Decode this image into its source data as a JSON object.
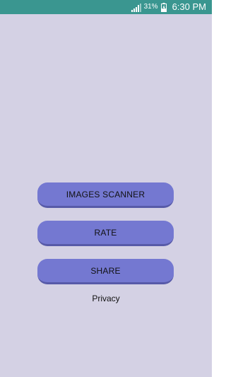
{
  "status_bar": {
    "battery_percent": "31%",
    "time": "6:30 PM",
    "icons": [
      "signal-icon",
      "battery-charging-icon"
    ]
  },
  "buttons": {
    "images_scanner": "IMAGES SCANNER",
    "rate": "RATE",
    "share": "SHARE"
  },
  "links": {
    "privacy": "Privacy"
  },
  "colors": {
    "status_bar": "#3a9690",
    "background": "#d4d1e4",
    "button": "#7478d1"
  }
}
